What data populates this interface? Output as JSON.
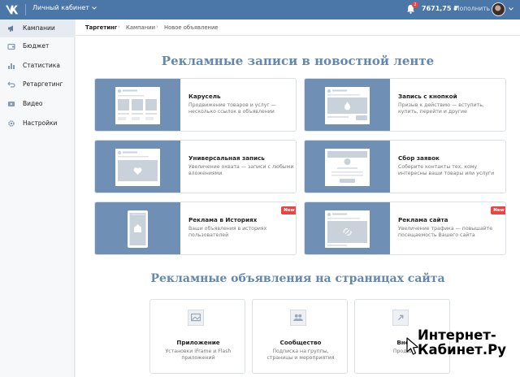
{
  "topbar": {
    "cabinet": "Личный кабинет",
    "notifications": "2",
    "balance": "7671,75 ₽",
    "topup": "Пополнить"
  },
  "sidebar": {
    "items": [
      {
        "label": "Кампании",
        "icon": "megaphone-icon",
        "active": true
      },
      {
        "label": "Бюджет",
        "icon": "wallet-icon"
      },
      {
        "label": "Статистика",
        "icon": "stats-icon"
      },
      {
        "label": "Ретаргетинг",
        "icon": "retarget-icon"
      },
      {
        "label": "Видео",
        "icon": "video-icon"
      },
      {
        "label": "Настройки",
        "icon": "gear-icon"
      }
    ]
  },
  "breadcrumb": [
    "Таргетинг",
    "Кампании",
    "Новое объявление"
  ],
  "section1": {
    "title": "Рекламные записи в новостной ленте",
    "cards": [
      {
        "title": "Карусель",
        "desc": "Продвижение товаров и услуг — несколько ссылок в объявлении",
        "mock": "carousel"
      },
      {
        "title": "Запись с кнопкой",
        "desc": "Призыв к действию — вступить, купить, перейти и другие",
        "mock": "button-post"
      },
      {
        "title": "Универсальная запись",
        "desc": "Увеличение охвата — записи с любыми вложениями",
        "mock": "universal"
      },
      {
        "title": "Сбор заявок",
        "desc": "Соберите контакты тех, кому интересны ваши товары или услуги",
        "mock": "leads"
      },
      {
        "title": "Реклама в Историях",
        "desc": "Ваши объявления в историях пользователей",
        "mock": "stories",
        "badge": "New"
      },
      {
        "title": "Реклама сайта",
        "desc": "Увеличение трафика — повышайте посещаемость Вашего сайта",
        "mock": "site",
        "badge": "New"
      }
    ]
  },
  "section2": {
    "title": "Рекламные объявления на страницах сайта",
    "cards": [
      {
        "title": "Приложение",
        "desc": "Установки iFrame и Flash приложений",
        "icon": "app-icon"
      },
      {
        "title": "Сообщество",
        "desc": "Подписка на группы, страницы и мероприятия",
        "icon": "community-icon"
      },
      {
        "title": "Вне",
        "desc": "Продви",
        "icon": "external-icon"
      }
    ]
  },
  "watermark": "Интернет-Кабинет.Ру",
  "colors": {
    "brand": "#4a76a8",
    "thumb": "#6f8fb5",
    "title": "#6488ad",
    "badge": "#e64646"
  }
}
